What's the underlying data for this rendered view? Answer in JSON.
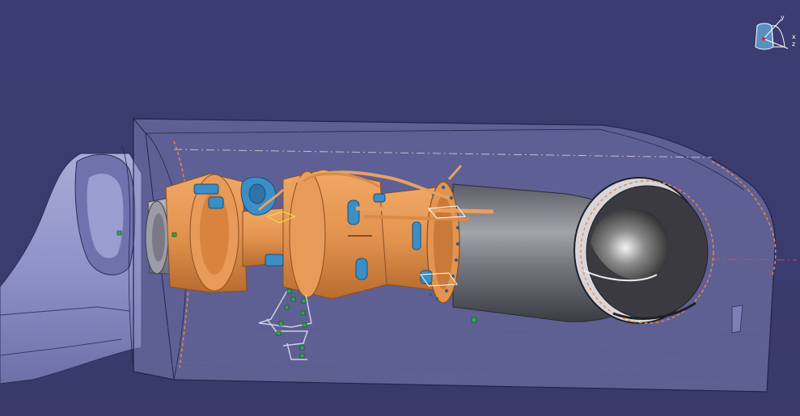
{
  "window": {
    "viewport_background": "#3a3b6e"
  },
  "compass": {
    "axis_y": "y",
    "axis_x": "x",
    "axis_z": "z"
  },
  "colors": {
    "engine_orange": "#e3944f",
    "engine_blue": "#3b8ec6",
    "nacelle_glass": "#8c8fc4",
    "exhaust_gray": "#8c8c94",
    "marker_green": "#2fa84a",
    "axis_line_red": "#d84a4a"
  },
  "icons": {
    "compass": "axis-compass-icon",
    "constraint_marker": "green-constraint-icon"
  }
}
